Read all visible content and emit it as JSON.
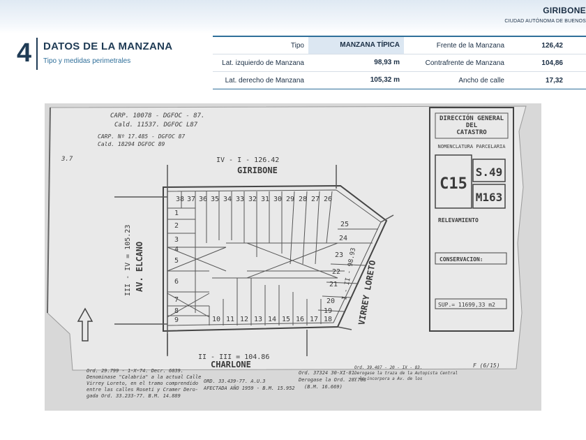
{
  "header": {
    "title": "GIRIBONE",
    "subtitle": "CIUDAD AUTÓNOMA DE BUENOS"
  },
  "section": {
    "number": "4",
    "title": "DATOS DE LA MANZANA",
    "subtitle": "Tipo y medidas perimetrales"
  },
  "table": {
    "rows": [
      {
        "label1": "Tipo",
        "value1": "MANZANA TÍPICA",
        "label2": "Frente de la Manzana",
        "value2": "126,42"
      },
      {
        "label1": "Lat. izquierdo de Manzana",
        "value1": "98,93 m",
        "label2": "Contrafrente de Manzana",
        "value2": "104,86"
      },
      {
        "label1": "Lat. derecho de Manzana",
        "value1": "105,32 m",
        "label2": "Ancho de calle",
        "value2": "17,32"
      }
    ]
  },
  "plan": {
    "street_top": "GIRIBONE",
    "street_bottom": "CHARLONE",
    "street_left": "AV. ELCANO",
    "street_right": "VIRREY LORETO",
    "top_measure": "IV - I - 126.42",
    "bottom_measure": "II - III = 104.86",
    "left_measure": "III - IV = 105.23",
    "right_measure": "I - II - 98.93",
    "stamp": {
      "line1": "DIRECCIÓN GENERAL",
      "line2": "DEL",
      "line3": "CATASTRO",
      "nomenclatura": "NOMENCLATURA PARCELARIA",
      "circ": "C15",
      "seccion": "S.49",
      "manzana": "M163",
      "relevamiento": "RELEVAMIENTO",
      "conservacion": "CONSERVACION:",
      "superficie": "SUP.= 11699,33 m2"
    },
    "notes": {
      "carp1": "CARP. 10078 - DGFOC - 87.",
      "carp2": "Cald. 11537. DGFOC L87",
      "carp3": "CARP. Nº 17.485 - DGFOC 87",
      "carp4": "Cald. 18294 DGFOC 89",
      "ord1": "Ord. 29.799 - 1-X-74. Decr. 6039.",
      "ord2": "Denominase \"Calabria\" a la actual Calle",
      "ord3": "Virrey Loreto, en el tramo comprendido",
      "ord4": "entre las calles Roseti y Cramer Dero-",
      "ord5": "gada Ord. 33.233-77.   B.M. 14.889",
      "ord6": "ORD. 33.439-77. A.U.3",
      "ord7": "AFECTADA AÑO 1959 - B.M. 15.952",
      "ord8": "Ord. 37324  30-XI-81",
      "ord9": "Derogase la Ord. 28.788",
      "ord10": "(B.M. 16.669)",
      "ord11": "Ord. 39.487 - 20 - IX - 83.",
      "ord12": "Derogase la traza de la Autopista Central",
      "ord13": "y lo incorpora a Av. de los",
      "figure_num": "F (6/15)",
      "code": "3.7"
    },
    "lots_top": [
      "38",
      "37",
      "36",
      "35",
      "34",
      "33",
      "32",
      "31",
      "30",
      "29",
      "28",
      "27",
      "26"
    ],
    "lots_left": [
      "1",
      "2",
      "3",
      "4",
      "5",
      "6",
      "7",
      "8",
      "9"
    ],
    "lots_bottom": [
      "10",
      "11",
      "12",
      "13",
      "14",
      "15",
      "16",
      "17",
      "18"
    ],
    "lots_right": [
      "25",
      "24",
      "23",
      "22",
      "21",
      "20",
      "19"
    ]
  }
}
